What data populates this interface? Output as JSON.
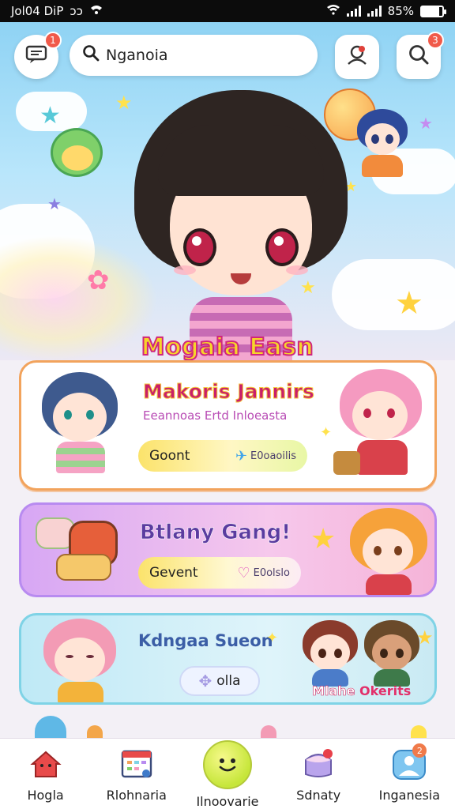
{
  "status_bar": {
    "time": "Jol04 DiP",
    "extra": "ɔɔ",
    "battery": "85%",
    "battery_level": 0.85
  },
  "header": {
    "chat_badge": "1",
    "search_value": "Nganoia",
    "notify_badge": "3"
  },
  "hero": {
    "title": "Mogaia Easn"
  },
  "cards": [
    {
      "title": "Makoris Jannirs",
      "subtitle": "Eeannoas Ertd Inloeasta",
      "button_label": "Goont",
      "button_meta": "E0oaoilis"
    },
    {
      "title": "Btlany Gang!",
      "button_label": "Gevent",
      "button_meta": "E0olslo"
    },
    {
      "title": "Kdngaa Sueon",
      "button_label": "olla",
      "tag_white": "Mlahe",
      "tag_red": "Okerits"
    }
  ],
  "bottom_nav": [
    {
      "label": "Hogla"
    },
    {
      "label": "Rlohnaria"
    },
    {
      "label": "Ilnoovarie"
    },
    {
      "label": "Sdnaty"
    },
    {
      "label": "Inganesia",
      "badge": "2"
    }
  ],
  "colors": {
    "accent_pink": "#d0267d",
    "accent_yellow": "#f6d52a",
    "badge_red": "#f05a4a"
  }
}
